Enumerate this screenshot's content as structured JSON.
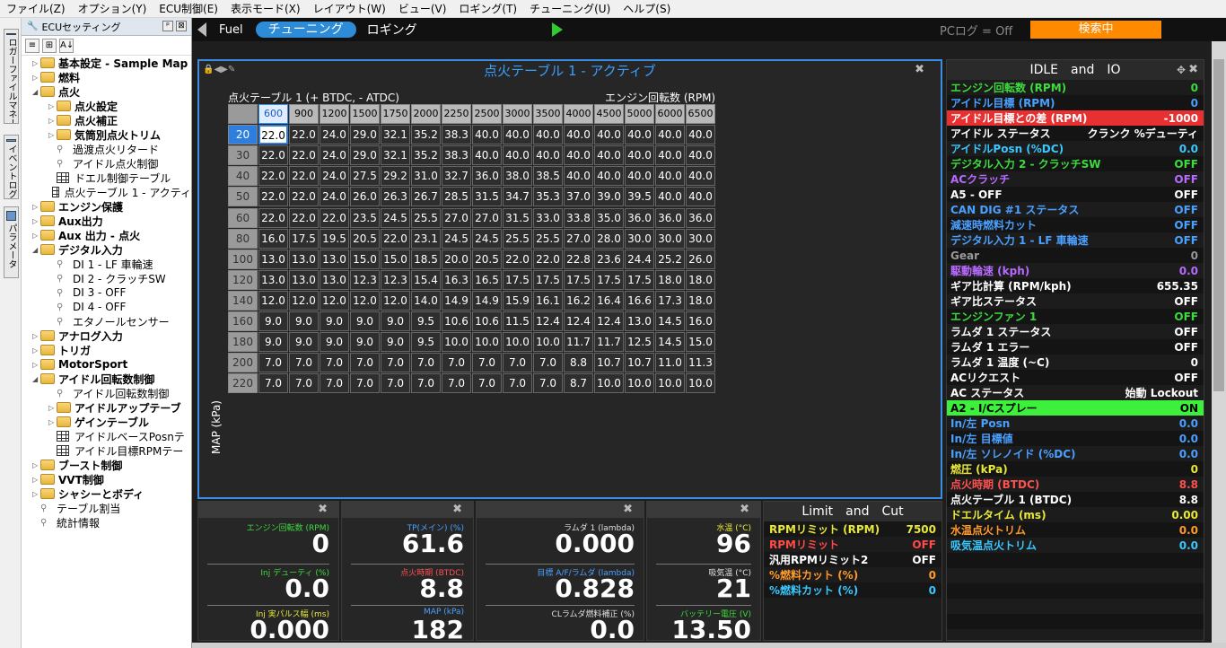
{
  "menu": [
    "ファイル(Z)",
    "オプション(Y)",
    "ECU制御(E)",
    "表示モード(X)",
    "レイアウト(W)",
    "ビュー(V)",
    "ロギング(T)",
    "チューニング(U)",
    "ヘルプ(S)"
  ],
  "vtabs": [
    "ロガーファイルマネージャ",
    "イベントログ",
    "パラメータ"
  ],
  "tree": {
    "title": "ECUセッティング",
    "pin": "ᵖ",
    "close": "⊠",
    "items": [
      {
        "label": "基本設定 - Sample Map",
        "lvl": 0,
        "type": "folder",
        "bold": true,
        "exp": "▷"
      },
      {
        "label": "燃料",
        "lvl": 0,
        "type": "folder",
        "bold": true,
        "exp": "▷"
      },
      {
        "label": "点火",
        "lvl": 0,
        "type": "folder",
        "bold": true,
        "exp": "◢"
      },
      {
        "label": "点火設定",
        "lvl": 1,
        "type": "folder",
        "bold": true,
        "exp": "▷"
      },
      {
        "label": "点火補正",
        "lvl": 1,
        "type": "folder",
        "bold": true,
        "exp": "▷"
      },
      {
        "label": "気筒別点火トリム",
        "lvl": 1,
        "type": "folder",
        "bold": true,
        "exp": "▷"
      },
      {
        "label": "過渡点火リタード",
        "lvl": 1,
        "type": "wrench",
        "bold": false,
        "exp": ""
      },
      {
        "label": "アイドル点火制御",
        "lvl": 1,
        "type": "wrench",
        "bold": false,
        "exp": ""
      },
      {
        "label": "ドエル制御テーブル",
        "lvl": 1,
        "type": "grid",
        "bold": false,
        "exp": ""
      },
      {
        "label": "点火テーブル 1 - アクティ",
        "lvl": 1,
        "type": "grid",
        "bold": false,
        "exp": ""
      },
      {
        "label": "エンジン保護",
        "lvl": 0,
        "type": "folder",
        "bold": true,
        "exp": "▷"
      },
      {
        "label": "Aux出力",
        "lvl": 0,
        "type": "folder",
        "bold": true,
        "exp": "▷"
      },
      {
        "label": "Aux 出力 - 点火",
        "lvl": 0,
        "type": "folder",
        "bold": true,
        "exp": "▷"
      },
      {
        "label": "デジタル入力",
        "lvl": 0,
        "type": "folder",
        "bold": true,
        "exp": "◢"
      },
      {
        "label": "DI 1 - LF 車輪速",
        "lvl": 1,
        "type": "wrench",
        "bold": false,
        "exp": ""
      },
      {
        "label": "DI 2 - クラッチSW",
        "lvl": 1,
        "type": "wrench",
        "bold": false,
        "exp": ""
      },
      {
        "label": "DI 3 - OFF",
        "lvl": 1,
        "type": "wrench",
        "bold": false,
        "exp": ""
      },
      {
        "label": "DI 4 - OFF",
        "lvl": 1,
        "type": "wrench",
        "bold": false,
        "exp": ""
      },
      {
        "label": "エタノールセンサー",
        "lvl": 1,
        "type": "wrench",
        "bold": false,
        "exp": ""
      },
      {
        "label": "アナログ入力",
        "lvl": 0,
        "type": "folder",
        "bold": true,
        "exp": "▷"
      },
      {
        "label": "トリガ",
        "lvl": 0,
        "type": "folder",
        "bold": true,
        "exp": "▷"
      },
      {
        "label": "MotorSport",
        "lvl": 0,
        "type": "folder",
        "bold": true,
        "exp": "▷"
      },
      {
        "label": "アイドル回転数制御",
        "lvl": 0,
        "type": "folder",
        "bold": true,
        "exp": "◢"
      },
      {
        "label": "アイドル回転数制御",
        "lvl": 1,
        "type": "wrench",
        "bold": false,
        "exp": ""
      },
      {
        "label": "アイドルアップテーブ",
        "lvl": 1,
        "type": "folder",
        "bold": true,
        "exp": "▷"
      },
      {
        "label": "ゲインテーブル",
        "lvl": 1,
        "type": "folder",
        "bold": true,
        "exp": "▷"
      },
      {
        "label": "アイドルベースPosnテ",
        "lvl": 1,
        "type": "grid",
        "bold": false,
        "exp": ""
      },
      {
        "label": "アイドル目標RPMテー",
        "lvl": 1,
        "type": "grid",
        "bold": false,
        "exp": ""
      },
      {
        "label": "ブースト制御",
        "lvl": 0,
        "type": "folder",
        "bold": true,
        "exp": "▷"
      },
      {
        "label": "VVT制御",
        "lvl": 0,
        "type": "folder",
        "bold": true,
        "exp": "▷"
      },
      {
        "label": "シャシーとボディ",
        "lvl": 0,
        "type": "folder",
        "bold": true,
        "exp": "▷"
      },
      {
        "label": "テーブル割当",
        "lvl": 0,
        "type": "wrench",
        "bold": false,
        "exp": ""
      },
      {
        "label": "統計情報",
        "lvl": 0,
        "type": "wrench",
        "bold": false,
        "exp": ""
      }
    ]
  },
  "topbar": {
    "fuel": "Fuel",
    "tuning": "チューニング",
    "logging": "ロギング",
    "pclog": "PCログ = Off",
    "search": "検索中"
  },
  "ign": {
    "title": "点火テーブル 1 - アクティブ",
    "subtitle": "点火テーブル 1 (+ BTDC, - ATDC)",
    "xaxis": "エンジン回転数 (RPM)",
    "yaxis": "MAP (kPa)",
    "rpm": [
      "600",
      "900",
      "1200",
      "1500",
      "1750",
      "2000",
      "2250",
      "2500",
      "3000",
      "3500",
      "4000",
      "4500",
      "5000",
      "6000",
      "6500"
    ],
    "map": [
      "20",
      "30",
      "40",
      "50",
      "60",
      "80",
      "100",
      "120",
      "140",
      "160",
      "180",
      "200",
      "220"
    ],
    "rows": [
      [
        "22.0",
        "22.0",
        "24.0",
        "29.0",
        "32.1",
        "35.2",
        "38.3",
        "40.0",
        "40.0",
        "40.0",
        "40.0",
        "40.0",
        "40.0",
        "40.0",
        "40.0"
      ],
      [
        "22.0",
        "22.0",
        "24.0",
        "29.0",
        "32.1",
        "35.2",
        "38.3",
        "40.0",
        "40.0",
        "40.0",
        "40.0",
        "40.0",
        "40.0",
        "40.0",
        "40.0"
      ],
      [
        "22.0",
        "22.0",
        "24.0",
        "27.5",
        "29.2",
        "31.0",
        "32.7",
        "36.0",
        "38.0",
        "38.5",
        "40.0",
        "40.0",
        "40.0",
        "40.0",
        "40.0"
      ],
      [
        "22.0",
        "22.0",
        "24.0",
        "26.0",
        "26.3",
        "26.7",
        "28.5",
        "31.5",
        "34.7",
        "35.3",
        "37.0",
        "39.0",
        "39.5",
        "40.0",
        "40.0"
      ],
      [
        "22.0",
        "22.0",
        "22.0",
        "23.5",
        "24.5",
        "25.5",
        "27.0",
        "27.0",
        "31.5",
        "33.0",
        "33.8",
        "35.0",
        "36.0",
        "36.0",
        "36.0"
      ],
      [
        "16.0",
        "17.5",
        "19.5",
        "20.5",
        "22.0",
        "23.1",
        "24.5",
        "24.5",
        "25.5",
        "25.5",
        "27.0",
        "28.0",
        "30.0",
        "30.0",
        "30.0"
      ],
      [
        "13.0",
        "13.0",
        "13.0",
        "15.0",
        "15.0",
        "18.5",
        "20.0",
        "20.5",
        "22.0",
        "22.0",
        "22.8",
        "23.6",
        "24.4",
        "25.2",
        "26.0"
      ],
      [
        "13.0",
        "13.0",
        "13.0",
        "12.3",
        "12.3",
        "15.4",
        "16.3",
        "16.5",
        "17.5",
        "17.5",
        "17.5",
        "17.5",
        "17.5",
        "18.0",
        "18.0"
      ],
      [
        "12.0",
        "12.0",
        "12.0",
        "12.0",
        "12.0",
        "14.0",
        "14.9",
        "14.9",
        "15.9",
        "16.1",
        "16.2",
        "16.4",
        "16.6",
        "17.3",
        "18.0"
      ],
      [
        "9.0",
        "9.0",
        "9.0",
        "9.0",
        "9.0",
        "9.5",
        "10.6",
        "10.6",
        "11.5",
        "12.4",
        "12.4",
        "12.4",
        "13.0",
        "14.5",
        "16.0"
      ],
      [
        "9.0",
        "9.0",
        "9.0",
        "9.0",
        "9.0",
        "9.5",
        "10.0",
        "10.0",
        "10.0",
        "10.0",
        "11.7",
        "11.7",
        "12.5",
        "14.5",
        "15.0"
      ],
      [
        "7.0",
        "7.0",
        "7.0",
        "7.0",
        "7.0",
        "7.0",
        "7.0",
        "7.0",
        "7.0",
        "7.0",
        "8.8",
        "10.7",
        "10.7",
        "11.0",
        "11.3"
      ],
      [
        "7.0",
        "7.0",
        "7.0",
        "7.0",
        "7.0",
        "7.0",
        "7.0",
        "7.0",
        "7.0",
        "7.0",
        "8.7",
        "10.0",
        "10.0",
        "10.0",
        "10.0"
      ]
    ]
  },
  "gauges": [
    {
      "items": [
        {
          "label": "エンジン回転数 (RPM)",
          "value": "0",
          "color": "#3cdc3c"
        },
        {
          "label": "Inj デューティ (%)",
          "value": "0.0",
          "color": "#3cdc3c"
        },
        {
          "label": "Inj 実パルス幅 (ms)",
          "value": "0.000",
          "color": "#e8e83a"
        }
      ]
    },
    {
      "items": [
        {
          "label": "TP(メイン) (%)",
          "value": "61.6",
          "color": "#4aa0ff"
        },
        {
          "label": "点火時期 (BTDC)",
          "value": "8.8",
          "color": "#ff5050"
        },
        {
          "label": "MAP (kPa)",
          "value": "182",
          "color": "#4aa0ff"
        }
      ]
    },
    {
      "items": [
        {
          "label": "ラムダ 1 (lambda)",
          "value": "0.000",
          "color": "#e0e0e0"
        },
        {
          "label": "目標 A/F/ラムダ (lambda)",
          "value": "0.828",
          "color": "#4aa0ff"
        },
        {
          "label": "CLラムダ燃料補正 (%)",
          "value": "0.0",
          "color": "#e0e0e0"
        }
      ]
    },
    {
      "items": [
        {
          "label": "水温 (°C)",
          "value": "96",
          "color": "#e8e83a"
        },
        {
          "label": "吸気温 (°C)",
          "value": "21",
          "color": "#e0e0e0"
        },
        {
          "label": "バッテリー電圧 (V)",
          "value": "13.50",
          "color": "#3cdc3c"
        }
      ]
    }
  ],
  "limit": {
    "title": "Limit　and　Cut",
    "rows": [
      {
        "label": "RPMリミット (RPM)",
        "value": "7500",
        "lc": "#e8e83a",
        "vc": "#e8e83a"
      },
      {
        "label": "RPMリミット",
        "value": "OFF",
        "lc": "#ff4a4a",
        "vc": "#ff4a4a"
      },
      {
        "label": "汎用RPMリミット2",
        "value": "OFF",
        "lc": "#ffffff",
        "vc": "#ffffff"
      },
      {
        "label": "%燃料カット (%)",
        "value": "0",
        "lc": "#ff9a2a",
        "vc": "#ff9a2a"
      },
      {
        "label": "%燃料カット (%)",
        "value": "0",
        "lc": "#39c8ff",
        "vc": "#39c8ff"
      }
    ]
  },
  "idle": {
    "title": "IDLE　and　IO",
    "rows": [
      {
        "label": "エンジン回転数 (RPM)",
        "value": "0",
        "lc": "#3cdc3c",
        "vc": "#3cdc3c",
        "bg": ""
      },
      {
        "label": "アイドル目標 (RPM)",
        "value": "0",
        "lc": "#4aa0ff",
        "vc": "#4aa0ff",
        "bg": ""
      },
      {
        "label": "アイドル目標との差 (RPM)",
        "value": "-1000",
        "lc": "#ffffff",
        "vc": "#ffffff",
        "bg": "#e83030"
      },
      {
        "label": "アイドル ステータス",
        "value": "クランク %デューティ",
        "lc": "#ffffff",
        "vc": "#ffffff",
        "bg": ""
      },
      {
        "label": "アイドルPosn (%DC)",
        "value": "0.0",
        "lc": "#39c8ff",
        "vc": "#39c8ff",
        "bg": ""
      },
      {
        "label": "デジタル入力 2 - クラッチSW",
        "value": "OFF",
        "lc": "#3cdc3c",
        "vc": "#3cdc3c",
        "bg": ""
      },
      {
        "label": "ACクラッチ",
        "value": "OFF",
        "lc": "#b86aff",
        "vc": "#b86aff",
        "bg": ""
      },
      {
        "label": "A5 - OFF",
        "value": "OFF",
        "lc": "#ffffff",
        "vc": "#ffffff",
        "bg": ""
      },
      {
        "label": "CAN DIG #1 ステータス",
        "value": "OFF",
        "lc": "#4aa0ff",
        "vc": "#4aa0ff",
        "bg": ""
      },
      {
        "label": "減速時燃料カット",
        "value": "OFF",
        "lc": "#4aa0ff",
        "vc": "#4aa0ff",
        "bg": ""
      },
      {
        "label": "デジタル入力 1 - LF 車輪速",
        "value": "OFF",
        "lc": "#4aa0ff",
        "vc": "#4aa0ff",
        "bg": ""
      },
      {
        "label": "Gear",
        "value": "0",
        "lc": "#999999",
        "vc": "#999999",
        "bg": ""
      },
      {
        "label": "駆動輪速 (kph)",
        "value": "0.0",
        "lc": "#b86aff",
        "vc": "#b86aff",
        "bg": ""
      },
      {
        "label": "ギア比計算 (RPM/kph)",
        "value": "655.35",
        "lc": "#ffffff",
        "vc": "#ffffff",
        "bg": ""
      },
      {
        "label": "ギア比ステータス",
        "value": "OFF",
        "lc": "#ffffff",
        "vc": "#ffffff",
        "bg": ""
      },
      {
        "label": "エンジンファン 1",
        "value": "OFF",
        "lc": "#3cdc3c",
        "vc": "#3cdc3c",
        "bg": ""
      },
      {
        "label": "ラムダ 1 ステータス",
        "value": "OFF",
        "lc": "#ffffff",
        "vc": "#ffffff",
        "bg": ""
      },
      {
        "label": "ラムダ 1 エラー",
        "value": "OFF",
        "lc": "#ffffff",
        "vc": "#ffffff",
        "bg": ""
      },
      {
        "label": "ラムダ 1 温度 (~C)",
        "value": "0",
        "lc": "#ffffff",
        "vc": "#ffffff",
        "bg": ""
      },
      {
        "label": "ACリクエスト",
        "value": "OFF",
        "lc": "#ffffff",
        "vc": "#ffffff",
        "bg": ""
      },
      {
        "label": "AC ステータス",
        "value": "始動 Lockout",
        "lc": "#ffffff",
        "vc": "#ffffff",
        "bg": ""
      },
      {
        "label": "A2 - I/Cスプレー",
        "value": "ON",
        "lc": "#000000",
        "vc": "#000000",
        "bg": "#3cf03c"
      },
      {
        "label": "In/左 Posn",
        "value": "0.0",
        "lc": "#4aa0ff",
        "vc": "#4aa0ff",
        "bg": ""
      },
      {
        "label": "In/左 目標値",
        "value": "0.0",
        "lc": "#4aa0ff",
        "vc": "#4aa0ff",
        "bg": ""
      },
      {
        "label": "In/左 ソレノイド (%DC)",
        "value": "0.0",
        "lc": "#4aa0ff",
        "vc": "#4aa0ff",
        "bg": ""
      },
      {
        "label": "燃圧 (kPa)",
        "value": "0",
        "lc": "#e8e83a",
        "vc": "#e8e83a",
        "bg": ""
      },
      {
        "label": "点火時期 (BTDC)",
        "value": "8.8",
        "lc": "#ff5050",
        "vc": "#ff5050",
        "bg": ""
      },
      {
        "label": "点火テーブル 1 (BTDC)",
        "value": "8.8",
        "lc": "#ffffff",
        "vc": "#ffffff",
        "bg": ""
      },
      {
        "label": "ドエルタイム (ms)",
        "value": "0.00",
        "lc": "#e8e83a",
        "vc": "#e8e83a",
        "bg": ""
      },
      {
        "label": "水温点火トリム",
        "value": "0.0",
        "lc": "#ff9a2a",
        "vc": "#ff9a2a",
        "bg": ""
      },
      {
        "label": "吸気温点火トリム",
        "value": "0.0",
        "lc": "#39c8ff",
        "vc": "#39c8ff",
        "bg": ""
      }
    ]
  },
  "colors": {
    "accent": "#3a8ee6",
    "search": "#ff8a00",
    "tuning_tab": "#2e8bd8"
  }
}
